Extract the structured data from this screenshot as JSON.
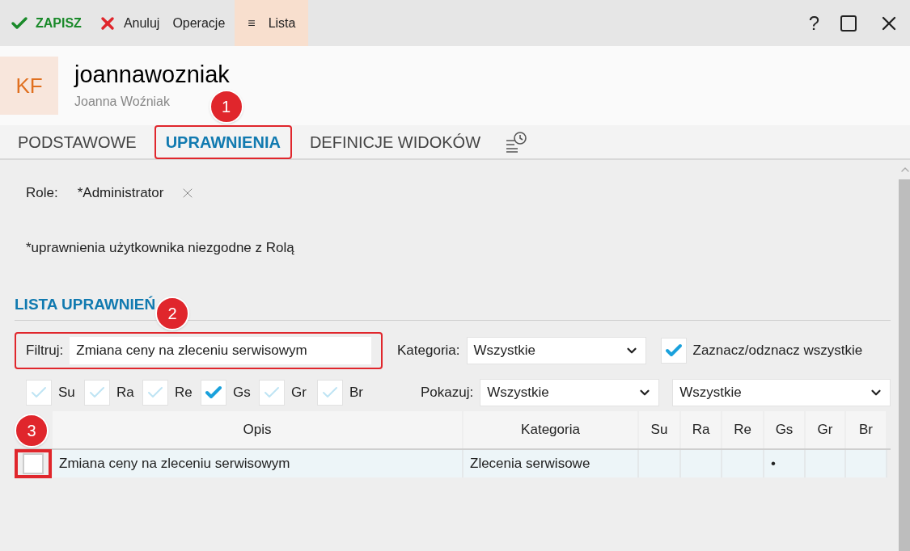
{
  "toolbar": {
    "save": "ZAPISZ",
    "cancel": "Anuluj",
    "operations": "Operacje",
    "list": {
      "icon": "≡",
      "label": "Lista",
      "selected": true
    }
  },
  "window_controls": {
    "help": "?"
  },
  "header": {
    "avatar": "KF",
    "login": "joannawozniak",
    "full_name": "Joanna Woźniak"
  },
  "tabs": [
    {
      "label": "PODSTAWOWE",
      "selected": false,
      "highlighted": false
    },
    {
      "label": "UPRAWNIENIA",
      "selected": true,
      "highlighted": true,
      "callout": "1"
    },
    {
      "label": "DEFINICJE WIDOKÓW",
      "selected": false,
      "highlighted": false
    }
  ],
  "roles": {
    "label": "Role:",
    "value": "*Administrator"
  },
  "note": "*uprawnienia użytkownika niezgodne z Rolą",
  "section_title": "LISTA UPRAWNIEŃ",
  "filter": {
    "label": "Filtruj:",
    "value": "Zmiana ceny na zleceniu serwisowym",
    "highlighted": true,
    "callout": "2"
  },
  "category": {
    "label": "Kategoria:",
    "value": "Wszystkie"
  },
  "select_all": {
    "label": "Zaznacz/odznacz wszystkie",
    "checked": true
  },
  "flags": [
    {
      "label": "Su",
      "checked": false
    },
    {
      "label": "Ra",
      "checked": false
    },
    {
      "label": "Re",
      "checked": false
    },
    {
      "label": "Gs",
      "checked": true
    },
    {
      "label": "Gr",
      "checked": false
    },
    {
      "label": "Br",
      "checked": false
    }
  ],
  "show": {
    "label": "Pokazuj:",
    "value": "Wszystkie",
    "value_2": "Wszystkie"
  },
  "table": {
    "columns": [
      "Opis",
      "Kategoria",
      "Su",
      "Ra",
      "Re",
      "Gs",
      "Gr",
      "Br"
    ],
    "check_callout": "3",
    "rows": [
      {
        "checked": false,
        "highlighted": true,
        "cells": [
          "Zmiana ceny na zleceniu serwisowym",
          "Zlecenia serwisowe",
          "",
          "",
          "",
          "•",
          "",
          ""
        ]
      }
    ]
  }
}
